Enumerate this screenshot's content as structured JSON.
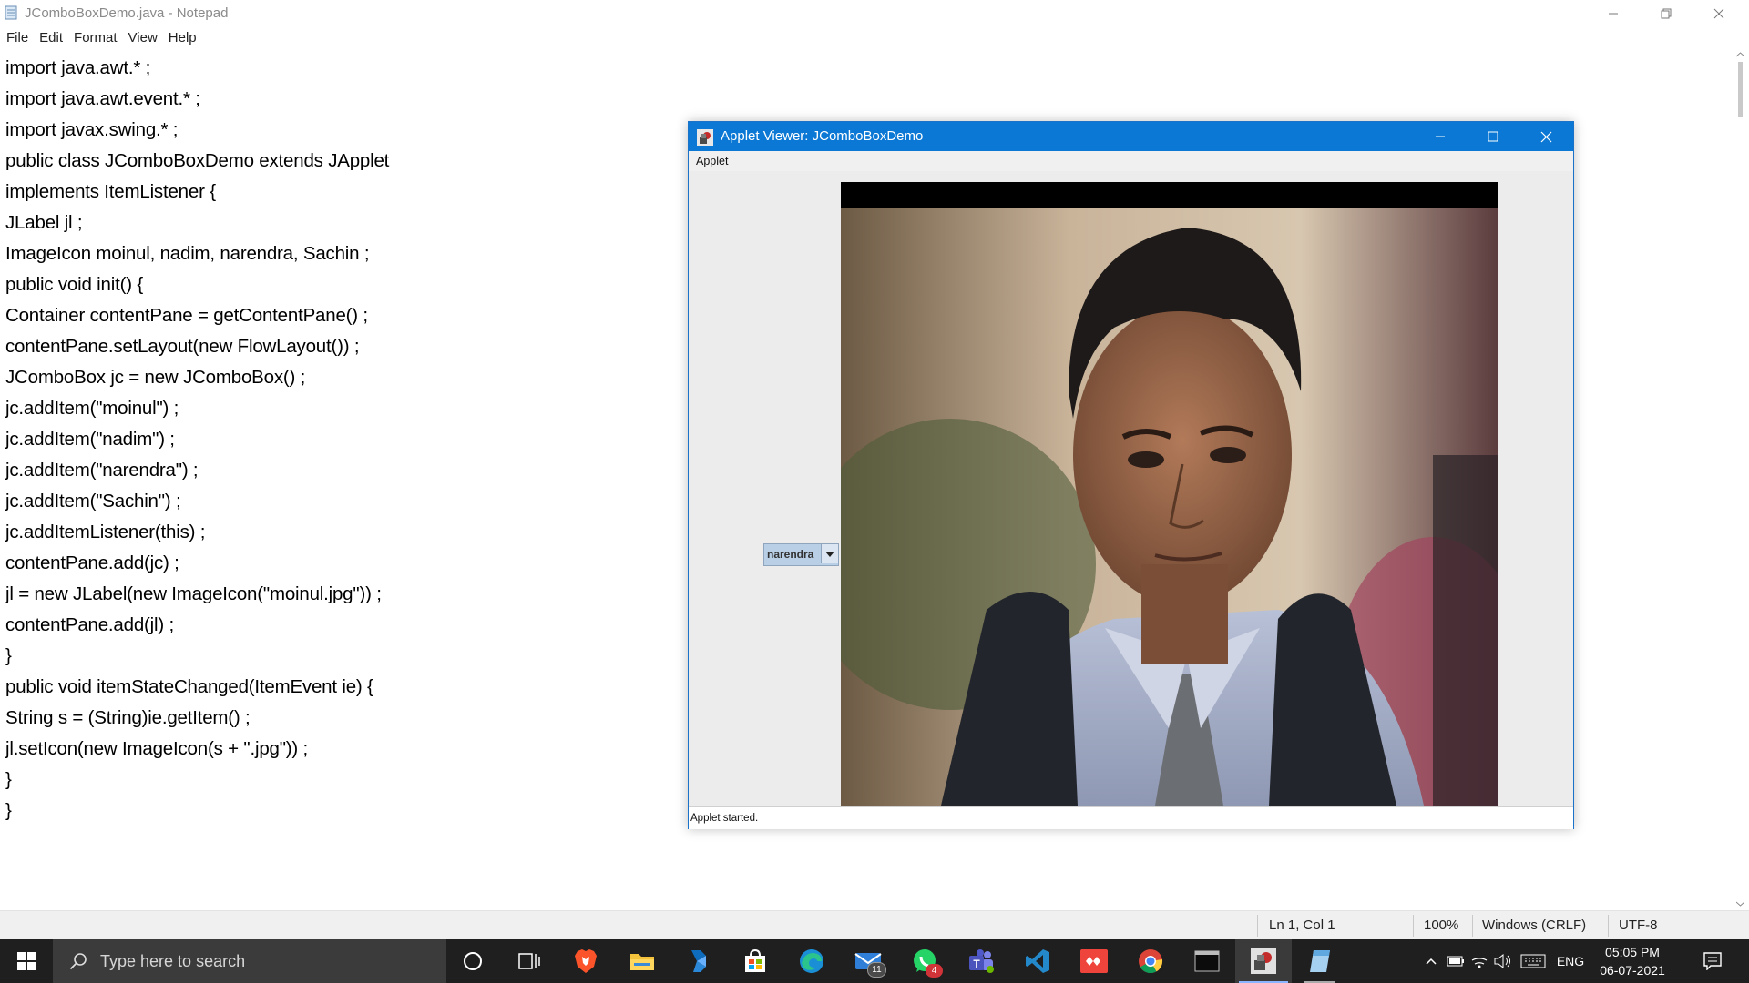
{
  "notepad": {
    "title": "JComboBoxDemo.java - Notepad",
    "menu": [
      "File",
      "Edit",
      "Format",
      "View",
      "Help"
    ],
    "code_lines": [
      "import java.awt.* ;",
      "import java.awt.event.* ;",
      "import javax.swing.* ;",
      "public class JComboBoxDemo extends JApplet",
      "implements ItemListener {",
      "JLabel jl ;",
      "ImageIcon moinul, nadim, narendra, Sachin ;",
      "public void init() {",
      "Container contentPane = getContentPane() ;",
      "contentPane.setLayout(new FlowLayout()) ;",
      "JComboBox jc = new JComboBox() ;",
      "jc.addItem(\"moinul\") ;",
      "jc.addItem(\"nadim\") ;",
      "jc.addItem(\"narendra\") ;",
      "jc.addItem(\"Sachin\") ;",
      "jc.addItemListener(this) ;",
      "contentPane.add(jc) ;",
      "jl = new JLabel(new ImageIcon(\"moinul.jpg\")) ;",
      "contentPane.add(jl) ;",
      "}",
      "public void itemStateChanged(ItemEvent ie) {",
      "String s = (String)ie.getItem() ;",
      "jl.setIcon(new ImageIcon(s + \".jpg\")) ;",
      "}",
      "}"
    ],
    "status": {
      "position": "Ln 1, Col 1",
      "zoom": "100%",
      "line_ending": "Windows (CRLF)",
      "encoding": "UTF-8"
    }
  },
  "applet_viewer": {
    "title": "Applet Viewer: JComboBoxDemo",
    "menu": "Applet",
    "combo_selected": "narendra",
    "status": "Applet started."
  },
  "taskbar": {
    "search_placeholder": "Type here to search",
    "apps": [
      "cortana",
      "task-view",
      "brave",
      "file-explorer",
      "power-automate",
      "microsoft-store",
      "edge",
      "mail",
      "whatsapp",
      "teams",
      "vscode",
      "anydesk",
      "chrome",
      "terminal",
      "java-applet",
      "notepad"
    ],
    "mail_badge": "11",
    "whatsapp_badge": "4",
    "language": "ENG",
    "time": "05:05 PM",
    "date": "06-07-2021"
  },
  "colors": {
    "window_accent": "#0a78d4",
    "taskbar_bg": "#1f1f1f",
    "combo_bg": "#b8cfe5"
  }
}
